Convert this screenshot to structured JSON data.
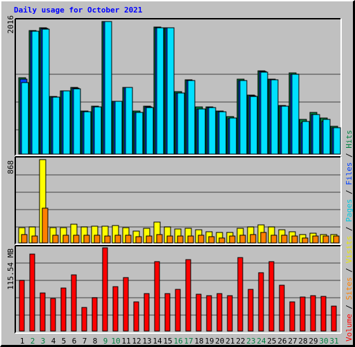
{
  "title": "Daily usage for October 2021",
  "colors": {
    "hits": "#008040",
    "files": "#0040ff",
    "pages": "#00e0ff",
    "visits": "#ffff00",
    "sites": "#ff8000",
    "volume": "#ff0000",
    "weekend_label": "#008040",
    "weekday_label": "#000000",
    "title": "#0000ff",
    "grid": "#808080",
    "background": "#c0c0c0"
  },
  "chart_data": [
    {
      "type": "bar",
      "title": "Daily usage for October 2021",
      "panel": "top",
      "ylabel": "2016",
      "ylim": [
        0,
        2016
      ],
      "grid": true,
      "categories": [
        "1",
        "2",
        "3",
        "4",
        "5",
        "6",
        "7",
        "8",
        "9",
        "10",
        "11",
        "12",
        "13",
        "14",
        "15",
        "16",
        "17",
        "18",
        "19",
        "20",
        "21",
        "22",
        "23",
        "24",
        "25",
        "26",
        "27",
        "28",
        "29",
        "30",
        "31"
      ],
      "series": [
        {
          "name": "Hits",
          "values": [
            1149,
            1859,
            1901,
            867,
            951,
            1003,
            648,
            721,
            1995,
            794,
            1003,
            648,
            721,
            1912,
            1901,
            940,
            1118,
            710,
            710,
            648,
            564,
            1128,
            888,
            1253,
            1128,
            731,
            1222,
            522,
            627,
            543,
            418
          ]
        },
        {
          "name": "Files",
          "values": [
            1128,
            1849,
            1891,
            857,
            951,
            992,
            637,
            710,
            1995,
            794,
            1003,
            627,
            710,
            1901,
            1901,
            919,
            1107,
            679,
            700,
            637,
            533,
            1107,
            877,
            1243,
            1118,
            721,
            1201,
            470,
            595,
            491,
            397
          ]
        },
        {
          "name": "Pages",
          "values": [
            1076,
            1849,
            1880,
            857,
            951,
            982,
            637,
            710,
            1995,
            794,
            1003,
            627,
            700,
            1901,
            1901,
            919,
            1107,
            679,
            700,
            637,
            543,
            1107,
            867,
            1233,
            1118,
            721,
            1201,
            491,
            595,
            522,
            397
          ]
        }
      ]
    },
    {
      "type": "bar",
      "panel": "middle",
      "ylabel": "868",
      "ylim": [
        0,
        868
      ],
      "grid": true,
      "categories": [
        "1",
        "2",
        "3",
        "4",
        "5",
        "6",
        "7",
        "8",
        "9",
        "10",
        "11",
        "12",
        "13",
        "14",
        "15",
        "16",
        "17",
        "18",
        "19",
        "20",
        "21",
        "22",
        "23",
        "24",
        "25",
        "26",
        "27",
        "28",
        "29",
        "30",
        "31"
      ],
      "series": [
        {
          "name": "Visits",
          "values": [
            159,
            166,
            868,
            159,
            159,
            195,
            166,
            174,
            174,
            181,
            159,
            123,
            152,
            217,
            166,
            145,
            152,
            137,
            116,
            109,
            109,
            152,
            166,
            188,
            166,
            137,
            116,
            87,
            101,
            87,
            87
          ]
        },
        {
          "name": "Sites",
          "values": [
            87,
            72,
            362,
            80,
            80,
            80,
            80,
            80,
            72,
            80,
            80,
            65,
            72,
            87,
            72,
            72,
            72,
            80,
            65,
            51,
            72,
            80,
            87,
            109,
            80,
            80,
            72,
            51,
            72,
            72,
            72
          ]
        }
      ]
    },
    {
      "type": "bar",
      "panel": "bottom",
      "ylabel": "115.54 MB",
      "ylim": [
        0,
        115.54
      ],
      "grid": true,
      "categories": [
        "1",
        "2",
        "3",
        "4",
        "5",
        "6",
        "7",
        "8",
        "9",
        "10",
        "11",
        "12",
        "13",
        "14",
        "15",
        "16",
        "17",
        "18",
        "19",
        "20",
        "21",
        "22",
        "23",
        "24",
        "25",
        "26",
        "27",
        "28",
        "29",
        "30",
        "31"
      ],
      "weekend_days": [
        "2",
        "3",
        "9",
        "10",
        "16",
        "17",
        "23",
        "24",
        "30",
        "31"
      ],
      "series": [
        {
          "name": "Volume",
          "unit": "MB",
          "values": [
            70.8,
            107.7,
            53.3,
            45.6,
            60.2,
            78.6,
            33.0,
            46.6,
            116.5,
            62.1,
            74.8,
            40.8,
            52.4,
            97.1,
            52.4,
            58.3,
            99.9,
            51.5,
            49.5,
            52.4,
            49.5,
            102.8,
            58.3,
            81.6,
            97.1,
            64.1,
            40.8,
            47.6,
            49.5,
            48.5,
            34.9
          ]
        }
      ]
    }
  ],
  "legend": [
    {
      "label": "Volume",
      "color": "#ff0000"
    },
    {
      "label": "Sites",
      "color": "#ff8000"
    },
    {
      "label": "Visits",
      "color": "#e8e800"
    },
    {
      "label": "Pages",
      "color": "#00c8e0"
    },
    {
      "label": "Files",
      "color": "#0040ff"
    },
    {
      "label": "Hits",
      "color": "#008040"
    }
  ],
  "legend_separator": " / "
}
